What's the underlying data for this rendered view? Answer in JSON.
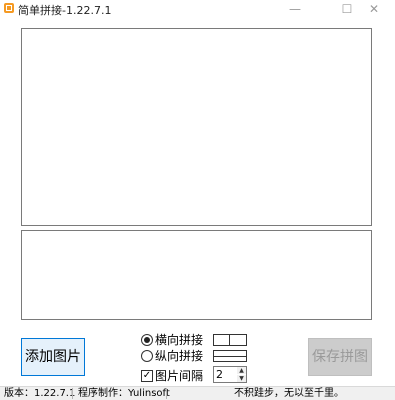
{
  "window": {
    "title": "简单拼接-1.22.7.1",
    "icon": "app-icon",
    "controls": {
      "minimize": "—",
      "maximize": "☐",
      "close": "✕"
    }
  },
  "buttons": {
    "add": "添加图片",
    "save": "保存拼图",
    "save_enabled": false
  },
  "options": {
    "horizontal": {
      "label": "横向拼接",
      "selected": true
    },
    "vertical": {
      "label": "纵向拼接",
      "selected": false
    },
    "spacing": {
      "label": "图片间隔",
      "checked": true,
      "value": "2"
    }
  },
  "status": {
    "version": "版本：1.22.7.1",
    "author": "程序制作：Yulinsoft",
    "motto": "不积跬步，无以至千里。"
  },
  "colors": {
    "accent": "#0078d7",
    "add_button_bg": "#e5f1fb",
    "disabled_button_bg": "#cccccc",
    "icon": "#f59a23"
  }
}
